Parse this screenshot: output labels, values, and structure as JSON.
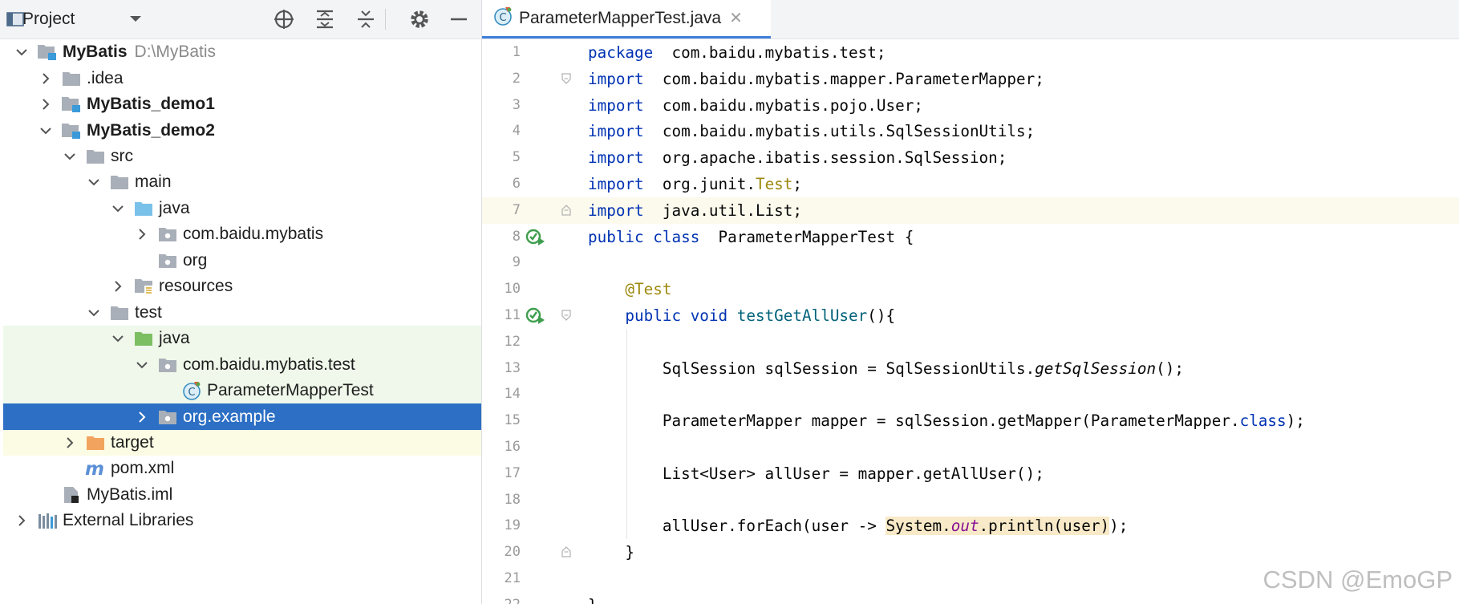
{
  "project_panel": {
    "title": "Project",
    "toolbar_icons": [
      "crosshair-icon",
      "expand-all-icon",
      "collapse-all-icon",
      "gear-icon",
      "minimize-icon"
    ]
  },
  "tree": [
    {
      "label": "MyBatis",
      "path": "D:\\MyBatis",
      "bold": true,
      "depth": 0,
      "arrow": "down",
      "icon": "module-folder"
    },
    {
      "label": ".idea",
      "depth": 1,
      "arrow": "right",
      "icon": "folder"
    },
    {
      "label": "MyBatis_demo1",
      "bold": true,
      "depth": 1,
      "arrow": "right",
      "icon": "module-folder"
    },
    {
      "label": "MyBatis_demo2",
      "bold": true,
      "depth": 1,
      "arrow": "down",
      "icon": "module-folder"
    },
    {
      "label": "src",
      "depth": 2,
      "arrow": "down",
      "icon": "folder"
    },
    {
      "label": "main",
      "depth": 3,
      "arrow": "down",
      "icon": "folder"
    },
    {
      "label": "java",
      "depth": 4,
      "arrow": "down",
      "icon": "source-folder"
    },
    {
      "label": "com.baidu.mybatis",
      "depth": 5,
      "arrow": "right",
      "icon": "package"
    },
    {
      "label": "org",
      "depth": 5,
      "arrow": "none",
      "icon": "package"
    },
    {
      "label": "resources",
      "depth": 4,
      "arrow": "right",
      "icon": "resources-folder"
    },
    {
      "label": "test",
      "depth": 3,
      "arrow": "down",
      "icon": "folder"
    },
    {
      "label": "java",
      "depth": 4,
      "arrow": "down",
      "icon": "test-folder",
      "state": "test-src"
    },
    {
      "label": "com.baidu.mybatis.test",
      "depth": 5,
      "arrow": "down",
      "icon": "package",
      "state": "test-src"
    },
    {
      "label": "ParameterMapperTest",
      "depth": 6,
      "arrow": "none",
      "icon": "java-class",
      "state": "test-src"
    },
    {
      "label": "org.example",
      "depth": 5,
      "arrow": "right",
      "icon": "package",
      "state": "selected"
    },
    {
      "label": "target",
      "depth": 2,
      "arrow": "right",
      "icon": "excluded-folder",
      "state": "excluded"
    },
    {
      "label": "pom.xml",
      "depth": 2,
      "arrow": "none",
      "icon": "maven-file"
    },
    {
      "label": "MyBatis.iml",
      "depth": 1,
      "arrow": "none",
      "icon": "iml-file"
    },
    {
      "label": "External Libraries",
      "depth": 0,
      "arrow": "right",
      "icon": "libraries"
    }
  ],
  "editor": {
    "tab_label": "ParameterMapperTest.java",
    "lines": [
      [
        [
          "kw",
          "package"
        ],
        [
          "",
          "  com.baidu.mybatis.test;"
        ]
      ],
      [
        [
          "kw",
          "import"
        ],
        [
          "",
          "  com.baidu.mybatis.mapper.ParameterMapper;"
        ]
      ],
      [
        [
          "kw",
          "import"
        ],
        [
          "",
          "  com.baidu.mybatis.pojo.User;"
        ]
      ],
      [
        [
          "kw",
          "import"
        ],
        [
          "",
          "  com.baidu.mybatis.utils.SqlSessionUtils;"
        ]
      ],
      [
        [
          "kw",
          "import"
        ],
        [
          "",
          "  org.apache.ibatis.session.SqlSession;"
        ]
      ],
      [
        [
          "kw",
          "import"
        ],
        [
          "",
          "  org.junit."
        ],
        [
          "ann",
          "Test"
        ],
        [
          "",
          ";"
        ]
      ],
      [
        [
          "kw",
          "import"
        ],
        [
          "",
          "  java.util.List;"
        ]
      ],
      [
        [
          "kw",
          "public class"
        ],
        [
          "",
          "  ParameterMapperTest {"
        ]
      ],
      [],
      [
        [
          "ann",
          "    @Test"
        ]
      ],
      [
        [
          "kw",
          "    public void"
        ],
        [
          "",
          " "
        ],
        [
          "fn",
          "testGetAllUser"
        ],
        [
          "",
          "(){"
        ]
      ],
      [],
      [
        [
          "",
          "        SqlSession sqlSession = SqlSessionUtils."
        ],
        [
          "it",
          "getSqlSession"
        ],
        [
          "",
          "();"
        ]
      ],
      [],
      [
        [
          "",
          "        ParameterMapper mapper = sqlSession.getMapper(ParameterMapper."
        ],
        [
          "kw",
          "class"
        ],
        [
          "",
          ");"
        ]
      ],
      [],
      [
        [
          "",
          "        List<User> allUser = mapper.getAllUser();"
        ]
      ],
      [],
      [
        [
          "",
          "        allUser.forEach(user -> "
        ],
        [
          "hl",
          "System."
        ],
        [
          "hlfld",
          "out"
        ],
        [
          "hl",
          ".println(user)"
        ],
        [
          "",
          ");"
        ]
      ],
      [
        [
          "",
          "    }"
        ]
      ],
      [],
      [
        [
          "",
          "}"
        ]
      ]
    ],
    "current_line": 7
  },
  "watermark": "CSDN @EmoGP"
}
